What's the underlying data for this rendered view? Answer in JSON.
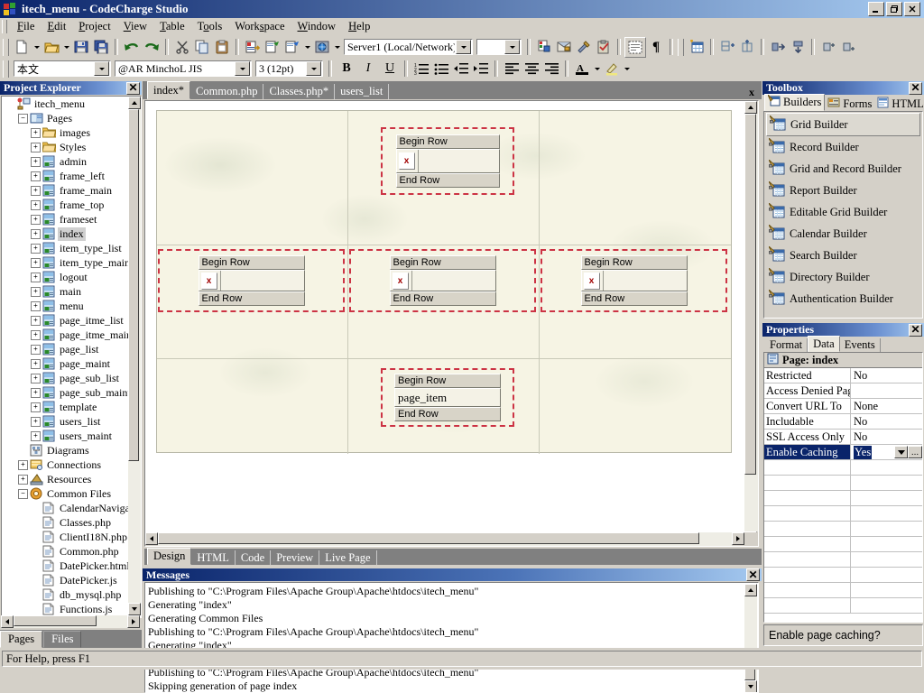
{
  "window": {
    "title": "itech_menu - CodeCharge Studio",
    "minimize_label": "_",
    "restore_label": "❐",
    "close_label": "✕"
  },
  "menubar": {
    "items": [
      {
        "label": "File",
        "accel": "F"
      },
      {
        "label": "Edit",
        "accel": "E"
      },
      {
        "label": "Project",
        "accel": "P"
      },
      {
        "label": "View",
        "accel": "V"
      },
      {
        "label": "Table",
        "accel": "T"
      },
      {
        "label": "Tools",
        "accel": "T"
      },
      {
        "label": "Workspace",
        "accel": "W"
      },
      {
        "label": "Window",
        "accel": "W"
      },
      {
        "label": "Help",
        "accel": "H"
      }
    ]
  },
  "toolbar_main": {
    "server_combo_value": "Server1 (Local/Network)",
    "buttons": [
      {
        "name": "new-file-button",
        "icon": "new-document-icon"
      },
      {
        "name": "open-file-button",
        "icon": "open-folder-icon"
      },
      {
        "name": "save-button",
        "icon": "floppy-disk-icon"
      },
      {
        "name": "save-all-button",
        "icon": "save-all-icon"
      },
      {
        "name": "undo-button",
        "icon": "undo-arrow-icon"
      },
      {
        "name": "redo-button",
        "icon": "redo-arrow-icon"
      },
      {
        "name": "cut-button",
        "icon": "scissors-icon"
      },
      {
        "name": "copy-button",
        "icon": "copy-icon"
      },
      {
        "name": "paste-button",
        "icon": "clipboard-paste-icon"
      },
      {
        "name": "publish-button",
        "icon": "publish-icon"
      },
      {
        "name": "generate-button",
        "icon": "generate-page-icon"
      },
      {
        "name": "generate-all-button",
        "icon": "generate-all-icon"
      },
      {
        "name": "live-page-button",
        "icon": "globe-icon"
      },
      {
        "name": "project-settings-button",
        "icon": "project-settings-icon"
      },
      {
        "name": "database-button",
        "icon": "database-icon"
      },
      {
        "name": "build-button",
        "icon": "hammer-wrench-icon"
      },
      {
        "name": "validate-button",
        "icon": "clipboard-check-icon"
      },
      {
        "name": "show-borders-button",
        "icon": "dashed-border-icon"
      },
      {
        "name": "show-paragraph-button",
        "icon": "pilcrow-icon"
      },
      {
        "name": "insert-table-button",
        "icon": "insert-table-icon"
      },
      {
        "name": "insert-row-button",
        "icon": "insert-row-icon"
      },
      {
        "name": "insert-column-button",
        "icon": "insert-column-icon"
      },
      {
        "name": "merge-cells-button",
        "icon": "merge-cells-icon"
      },
      {
        "name": "split-cells-button",
        "icon": "split-cells-icon"
      },
      {
        "name": "delete-row-button",
        "icon": "delete-row-icon"
      },
      {
        "name": "delete-column-button",
        "icon": "delete-column-icon"
      }
    ]
  },
  "toolbar_format": {
    "style_combo_value": "本文",
    "font_combo_value": "@AR MinchoL JIS",
    "size_combo_value": "3 (12pt)",
    "bold_label": "B",
    "italic_label": "I",
    "underline_label": "U",
    "buttons": [
      {
        "name": "ordered-list-button",
        "icon": "numbered-list-icon"
      },
      {
        "name": "unordered-list-button",
        "icon": "bulleted-list-icon"
      },
      {
        "name": "decrease-indent-button",
        "icon": "outdent-icon"
      },
      {
        "name": "increase-indent-button",
        "icon": "indent-icon"
      },
      {
        "name": "align-left-button",
        "icon": "align-left-icon"
      },
      {
        "name": "align-center-button",
        "icon": "align-center-icon"
      },
      {
        "name": "align-right-button",
        "icon": "align-right-icon"
      },
      {
        "name": "font-color-button",
        "icon": "font-color-icon"
      },
      {
        "name": "highlight-button",
        "icon": "highlighter-icon"
      }
    ]
  },
  "project_explorer": {
    "title": "Project Explorer",
    "close_label": "✕",
    "root": "itech_menu",
    "nodes": [
      {
        "label": "itech_menu",
        "indent": 0,
        "icon": "project-root-icon",
        "expander": ""
      },
      {
        "label": "Pages",
        "indent": 1,
        "icon": "pages-folder-icon",
        "expander": "−"
      },
      {
        "label": "images",
        "indent": 2,
        "icon": "folder-icon",
        "expander": "+"
      },
      {
        "label": "Styles",
        "indent": 2,
        "icon": "folder-icon",
        "expander": "+"
      },
      {
        "label": "admin",
        "indent": 2,
        "icon": "page-icon",
        "expander": "+"
      },
      {
        "label": "frame_left",
        "indent": 2,
        "icon": "page-icon",
        "expander": "+"
      },
      {
        "label": "frame_main",
        "indent": 2,
        "icon": "page-icon",
        "expander": "+"
      },
      {
        "label": "frame_top",
        "indent": 2,
        "icon": "page-icon",
        "expander": "+"
      },
      {
        "label": "frameset",
        "indent": 2,
        "icon": "page-icon",
        "expander": "+"
      },
      {
        "label": "index",
        "indent": 2,
        "icon": "page-icon",
        "expander": "+",
        "selected": true
      },
      {
        "label": "item_type_list",
        "indent": 2,
        "icon": "page-icon",
        "expander": "+"
      },
      {
        "label": "item_type_main",
        "indent": 2,
        "icon": "page-icon",
        "expander": "+"
      },
      {
        "label": "logout",
        "indent": 2,
        "icon": "page-icon",
        "expander": "+"
      },
      {
        "label": "main",
        "indent": 2,
        "icon": "page-icon",
        "expander": "+"
      },
      {
        "label": "menu",
        "indent": 2,
        "icon": "page-icon",
        "expander": "+"
      },
      {
        "label": "page_itme_list",
        "indent": 2,
        "icon": "page-icon",
        "expander": "+"
      },
      {
        "label": "page_itme_main",
        "indent": 2,
        "icon": "page-icon",
        "expander": "+"
      },
      {
        "label": "page_list",
        "indent": 2,
        "icon": "page-icon",
        "expander": "+"
      },
      {
        "label": "page_maint",
        "indent": 2,
        "icon": "page-icon",
        "expander": "+"
      },
      {
        "label": "page_sub_list",
        "indent": 2,
        "icon": "page-icon",
        "expander": "+"
      },
      {
        "label": "page_sub_maint",
        "indent": 2,
        "icon": "page-icon",
        "expander": "+"
      },
      {
        "label": "template",
        "indent": 2,
        "icon": "page-icon",
        "expander": "+"
      },
      {
        "label": "users_list",
        "indent": 2,
        "icon": "page-icon",
        "expander": "+"
      },
      {
        "label": "users_maint",
        "indent": 2,
        "icon": "page-icon",
        "expander": "+"
      },
      {
        "label": "Diagrams",
        "indent": 1,
        "icon": "diagrams-icon",
        "expander": ""
      },
      {
        "label": "Connections",
        "indent": 1,
        "icon": "connections-icon",
        "expander": "+"
      },
      {
        "label": "Resources",
        "indent": 1,
        "icon": "resources-icon",
        "expander": "+"
      },
      {
        "label": "Common Files",
        "indent": 1,
        "icon": "common-files-icon",
        "expander": "−"
      },
      {
        "label": "CalendarNaviga",
        "indent": 2,
        "icon": "file-icon",
        "expander": ""
      },
      {
        "label": "Classes.php",
        "indent": 2,
        "icon": "file-icon",
        "expander": ""
      },
      {
        "label": "ClientI18N.php",
        "indent": 2,
        "icon": "file-icon",
        "expander": ""
      },
      {
        "label": "Common.php",
        "indent": 2,
        "icon": "file-icon",
        "expander": ""
      },
      {
        "label": "DatePicker.html",
        "indent": 2,
        "icon": "file-icon",
        "expander": ""
      },
      {
        "label": "DatePicker.js",
        "indent": 2,
        "icon": "file-icon",
        "expander": ""
      },
      {
        "label": "db_mysql.php",
        "indent": 2,
        "icon": "file-icon",
        "expander": ""
      },
      {
        "label": "Functions.js",
        "indent": 2,
        "icon": "file-icon",
        "expander": ""
      }
    ],
    "bottom_tabs": [
      {
        "label": "Pages",
        "active": true
      },
      {
        "label": "Files",
        "active": false
      }
    ]
  },
  "document_tabs": [
    {
      "label": "index*",
      "active": true
    },
    {
      "label": "Common.php",
      "active": false
    },
    {
      "label": "Classes.php*",
      "active": false
    },
    {
      "label": "users_list",
      "active": false
    }
  ],
  "document_close_label": "x",
  "designer": {
    "row_labels": {
      "begin": "Begin Row",
      "end": "End Row"
    },
    "x_marker": "x",
    "page_item_label": "page_item",
    "blocks": [
      {
        "cell": "r1c2",
        "type": "row-block",
        "has_x": true
      },
      {
        "cell": "r2c1",
        "type": "row-block",
        "has_x": true
      },
      {
        "cell": "r2c2",
        "type": "row-block",
        "has_x": true
      },
      {
        "cell": "r2c3",
        "type": "row-block",
        "has_x": true
      },
      {
        "cell": "r3c2",
        "type": "row-block",
        "has_x": false,
        "text": "page_item"
      }
    ]
  },
  "view_tabs": [
    {
      "label": "Design",
      "active": true
    },
    {
      "label": "HTML",
      "active": false
    },
    {
      "label": "Code",
      "active": false
    },
    {
      "label": "Preview",
      "active": false
    },
    {
      "label": "Live Page",
      "active": false
    }
  ],
  "messages": {
    "title": "Messages",
    "close_label": "✕",
    "lines": [
      "Publishing to \"C:\\Program Files\\Apache Group\\Apache\\htdocs\\itech_menu\"",
      "Generating \"index\"",
      "Generating Common Files",
      "Publishing to \"C:\\Program Files\\Apache Group\\Apache\\htdocs\\itech_menu\"",
      "Generating \"index\"",
      "Generating Common Files",
      "Publishing to \"C:\\Program Files\\Apache Group\\Apache\\htdocs\\itech_menu\"",
      "Skipping generation of page index"
    ]
  },
  "toolbox": {
    "title": "Toolbox",
    "close_label": "✕",
    "tabs": [
      {
        "label": "Builders",
        "icon": "builders-icon",
        "active": true
      },
      {
        "label": "Forms",
        "icon": "forms-icon",
        "active": false
      },
      {
        "label": "HTML",
        "icon": "html-icon",
        "active": false
      }
    ],
    "items": [
      {
        "label": "Grid Builder",
        "icon": "grid-builder-icon",
        "hover": true
      },
      {
        "label": "Record Builder",
        "icon": "record-builder-icon"
      },
      {
        "label": "Grid and Record Builder",
        "icon": "grid-record-builder-icon"
      },
      {
        "label": "Report Builder",
        "icon": "report-builder-icon"
      },
      {
        "label": "Editable Grid Builder",
        "icon": "editable-grid-builder-icon"
      },
      {
        "label": "Calendar Builder",
        "icon": "calendar-builder-icon"
      },
      {
        "label": "Search Builder",
        "icon": "search-builder-icon"
      },
      {
        "label": "Directory Builder",
        "icon": "directory-builder-icon"
      },
      {
        "label": "Authentication Builder",
        "icon": "authentication-builder-icon"
      }
    ]
  },
  "properties": {
    "title": "Properties",
    "close_label": "✕",
    "tabs": [
      {
        "label": "Format",
        "active": false
      },
      {
        "label": "Data",
        "active": true
      },
      {
        "label": "Events",
        "active": false
      }
    ],
    "caption": "Page: index",
    "caption_icon": "page-properties-icon",
    "rows": [
      {
        "name": "Restricted",
        "value": "No"
      },
      {
        "name": "Access Denied Pag",
        "value": ""
      },
      {
        "name": "Convert URL To",
        "value": "None"
      },
      {
        "name": "Includable",
        "value": "No"
      },
      {
        "name": "SSL Access Only",
        "value": "No"
      },
      {
        "name": "Enable Caching",
        "value": "Yes",
        "selected": true,
        "has_dropdown": true,
        "has_ellipsis": true
      }
    ],
    "empty_rows": 10,
    "hint": "Enable page caching?"
  },
  "status_bar": {
    "text": "For Help, press F1"
  },
  "colors": {
    "titlebar_start": "#0a246a",
    "titlebar_end": "#a6caf0",
    "chrome": "#d4d0c8",
    "selection": "#0a246a",
    "row_block_border": "#cc3344",
    "canvas_page": "#f6f4e4",
    "tab_strip": "#808080"
  }
}
